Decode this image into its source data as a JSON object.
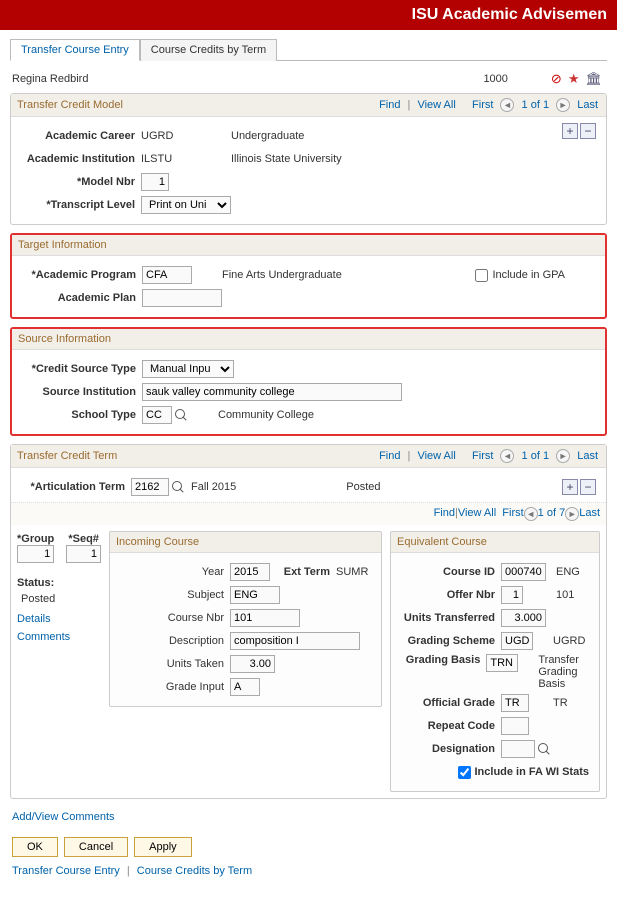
{
  "banner": {
    "title": "ISU Academic Advisemen"
  },
  "tabs": [
    {
      "label": "Transfer Course Entry",
      "active": true
    },
    {
      "label": "Course Credits by Term",
      "active": false
    }
  ],
  "header": {
    "name": "Regina Redbird",
    "id": "1000"
  },
  "model_panel": {
    "title": "Transfer Credit Model",
    "nav": {
      "find": "Find",
      "view_all": "View All",
      "first": "First",
      "pos": "1 of 1",
      "last": "Last"
    },
    "academic_career_lbl": "Academic Career",
    "academic_career_val": "UGRD",
    "academic_career_desc": "Undergraduate",
    "academic_institution_lbl": "Academic Institution",
    "academic_institution_val": "ILSTU",
    "academic_institution_desc": "Illinois State University",
    "model_nbr_lbl": "*Model Nbr",
    "model_nbr_val": "1",
    "transcript_level_lbl": "*Transcript Level",
    "transcript_level_val": "Print on Uni"
  },
  "target_panel": {
    "title": "Target Information",
    "academic_program_lbl": "*Academic Program",
    "academic_program_val": "CFA",
    "academic_program_desc": "Fine Arts Undergraduate",
    "include_gpa_lbl": "Include in GPA",
    "include_gpa_checked": false,
    "academic_plan_lbl": "Academic Plan",
    "academic_plan_val": ""
  },
  "source_panel": {
    "title": "Source Information",
    "credit_source_type_lbl": "*Credit Source Type",
    "credit_source_type_val": "Manual Inpu",
    "source_institution_lbl": "Source Institution",
    "source_institution_val": "sauk valley community college",
    "school_type_lbl": "School Type",
    "school_type_val": "CC",
    "school_type_desc": "Community College"
  },
  "term_panel": {
    "title": "Transfer Credit Term",
    "nav": {
      "find": "Find",
      "view_all": "View All",
      "first": "First",
      "pos": "1 of 1",
      "last": "Last"
    },
    "artic_term_lbl": "*Articulation Term",
    "artic_term_val": "2162",
    "artic_term_desc": "Fall 2015",
    "posted_lbl": "Posted",
    "inner_nav": {
      "find": "Find",
      "view_all": "View All",
      "first": "First",
      "pos": "1 of 7",
      "last": "Last"
    }
  },
  "seq": {
    "group_lbl": "*Group",
    "seq_lbl": "*Seq#",
    "group_val": "1",
    "seq_val": "1",
    "status_lbl": "Status:",
    "status_val": "Posted",
    "details_link": "Details",
    "comments_link": "Comments"
  },
  "incoming": {
    "title": "Incoming Course",
    "year_lbl": "Year",
    "year_val": "2015",
    "ext_term_lbl": "Ext Term",
    "ext_term_val": "SUMR",
    "subject_lbl": "Subject",
    "subject_val": "ENG",
    "course_nbr_lbl": "Course Nbr",
    "course_nbr_val": "101",
    "description_lbl": "Description",
    "description_val": "composition I",
    "units_taken_lbl": "Units Taken",
    "units_taken_val": "3.00",
    "grade_input_lbl": "Grade Input",
    "grade_input_val": "A"
  },
  "equivalent": {
    "title": "Equivalent Course",
    "course_id_lbl": "Course ID",
    "course_id_val": "000740",
    "course_id_desc": "ENG",
    "offer_nbr_lbl": "Offer Nbr",
    "offer_nbr_val": "1",
    "offer_nbr_desc": "101",
    "units_transferred_lbl": "Units Transferred",
    "units_transferred_val": "3.000",
    "grading_scheme_lbl": "Grading Scheme",
    "grading_scheme_val": "UGD",
    "grading_scheme_desc": "UGRD",
    "grading_basis_lbl": "Grading Basis",
    "grading_basis_val": "TRN",
    "grading_basis_desc": "Transfer Grading Basis",
    "official_grade_lbl": "Official Grade",
    "official_grade_val": "TR",
    "official_grade_desc": "TR",
    "repeat_code_lbl": "Repeat Code",
    "repeat_code_val": "",
    "designation_lbl": "Designation",
    "designation_val": "",
    "include_fa_lbl": "Include in FA WI Stats",
    "include_fa_checked": true
  },
  "addview_comments": "Add/View Comments",
  "buttons": {
    "ok": "OK",
    "cancel": "Cancel",
    "apply": "Apply"
  },
  "footer": {
    "a": "Transfer Course Entry",
    "b": "Course Credits by Term"
  }
}
